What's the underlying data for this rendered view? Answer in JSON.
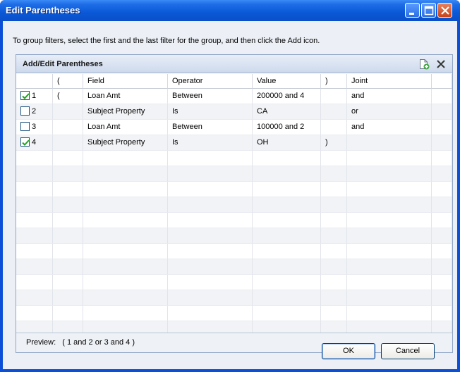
{
  "window": {
    "title": "Edit Parentheses"
  },
  "instructions": "To group filters, select the first and the last filter for the group, and then click the Add icon.",
  "panel": {
    "title": "Add/Edit Parentheses",
    "add_icon": "add-document-icon",
    "delete_icon": "close-x-icon"
  },
  "columns": [
    "",
    "(",
    "Field",
    "Operator",
    "Value",
    ")",
    "Joint",
    ""
  ],
  "rows": [
    {
      "checked": true,
      "num": "1",
      "open": "(",
      "field": "Loan Amt",
      "operator": "Between",
      "value": "200000 and 4",
      "close": "",
      "joint": "and"
    },
    {
      "checked": false,
      "num": "2",
      "open": "",
      "field": "Subject Property",
      "operator": "Is",
      "value": "CA",
      "close": "",
      "joint": "or"
    },
    {
      "checked": false,
      "num": "3",
      "open": "",
      "field": "Loan Amt",
      "operator": "Between",
      "value": "100000 and 2",
      "close": "",
      "joint": "and"
    },
    {
      "checked": true,
      "num": "4",
      "open": "",
      "field": "Subject Property",
      "operator": "Is",
      "value": "OH",
      "close": ")",
      "joint": ""
    }
  ],
  "preview": {
    "label": "Preview:",
    "value": "( 1 and 2 or 3 and 4 )"
  },
  "buttons": {
    "ok": "OK",
    "cancel": "Cancel"
  },
  "colors": {
    "title_bar": "#0a58d6",
    "client_bg": "#ecf0f6",
    "check_mark": "#21a121"
  }
}
